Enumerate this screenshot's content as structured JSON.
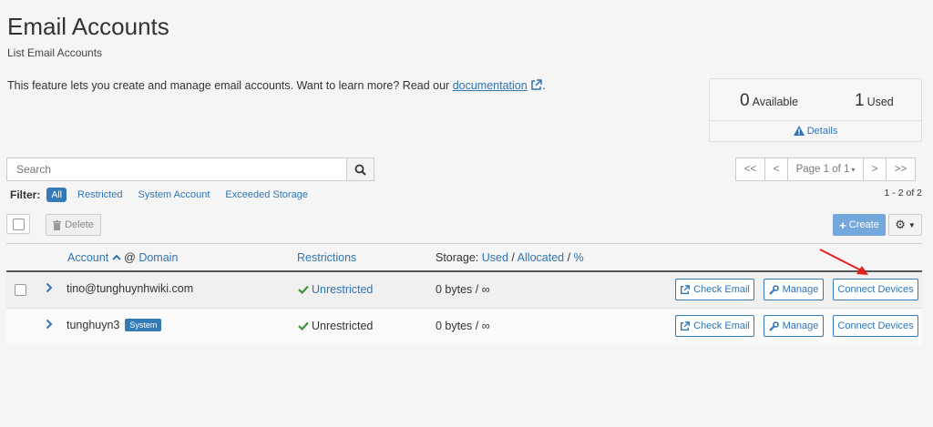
{
  "page": {
    "title": "Email Accounts",
    "subtitle": "List Email Accounts",
    "intro_text": "This feature lets you create and manage email accounts. Want to learn more? Read our ",
    "intro_link": "documentation",
    "intro_end": "."
  },
  "stats": {
    "available_count": "0",
    "available_label": "Available",
    "used_count": "1",
    "used_label": "Used",
    "details_label": "Details"
  },
  "search": {
    "placeholder": "Search"
  },
  "pagination": {
    "first": "<<",
    "prev": "<",
    "page_label": "Page 1 of 1",
    "next": ">",
    "last": ">>",
    "count": "1 - 2 of 2"
  },
  "filter": {
    "label": "Filter:",
    "options": [
      "All",
      "Restricted",
      "System Account",
      "Exceeded Storage"
    ],
    "active": "All"
  },
  "toolbar": {
    "delete_label": "Delete",
    "create_label": "Create"
  },
  "table": {
    "headers": {
      "account": "Account",
      "at_domain": "@",
      "domain": "Domain",
      "restrictions": "Restrictions",
      "storage_prefix": "Storage:",
      "used": "Used",
      "allocated": "Allocated",
      "percent": "%"
    },
    "rows": [
      {
        "account": "tino@tunghuynhwiki.com",
        "badge": "",
        "restriction": "Unrestricted",
        "storage": "0 bytes / ∞",
        "actions": [
          "Check Email",
          "Manage",
          "Connect Devices"
        ]
      },
      {
        "account": "tunghuyn3",
        "badge": "System",
        "restriction": "Unrestricted",
        "storage": "0 bytes / ∞",
        "actions": [
          "Check Email",
          "Manage",
          "Connect Devices"
        ]
      }
    ]
  },
  "colors": {
    "link": "#2f75b5",
    "primary": "#337ab7",
    "success": "#3c9440",
    "annotation_arrow": "#e0201c"
  },
  "icons": [
    "external-link-icon",
    "warning-icon",
    "search-icon",
    "trash-icon",
    "plus-icon",
    "gear-icon",
    "caret-down-icon",
    "sort-up-icon",
    "chevron-right-icon",
    "check-icon",
    "edit-icon",
    "wrench-icon",
    "arrow-icon"
  ]
}
